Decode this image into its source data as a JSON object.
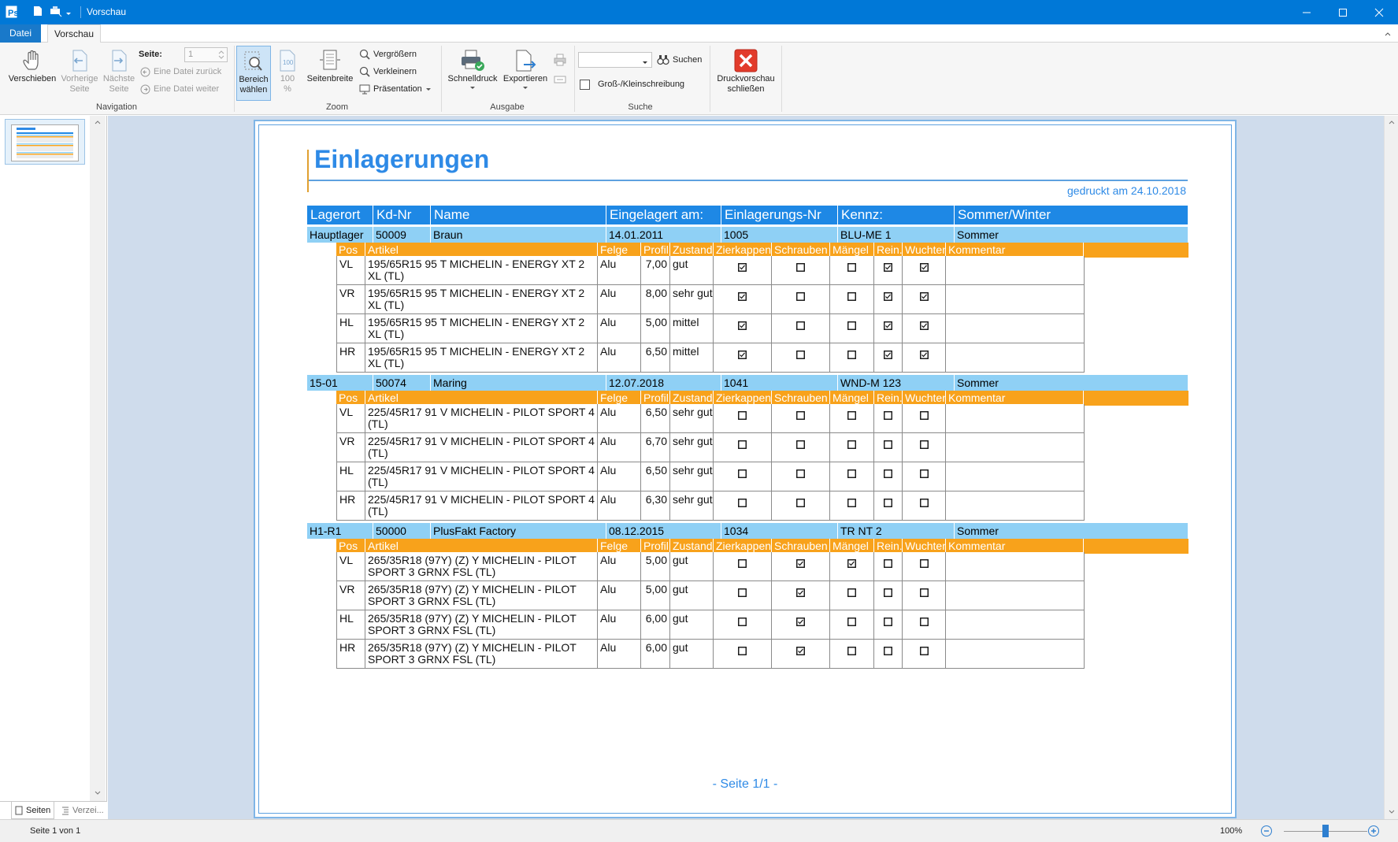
{
  "window": {
    "title": "Vorschau"
  },
  "menu_tabs": [
    {
      "label": "Datei"
    },
    {
      "label": "Vorschau"
    }
  ],
  "ribbon": {
    "navigation": {
      "group_label": "Navigation",
      "move_label": "Verschieben",
      "prev_label_1": "Vorherige",
      "prev_label_2": "Seite",
      "next_label_1": "Nächste",
      "next_label_2": "Seite",
      "page_label": "Seite:",
      "page_value": "1",
      "file_back_label": "Eine Datei zurück",
      "file_fwd_label": "Eine Datei weiter"
    },
    "zoom": {
      "group_label": "Zoom",
      "area_label_1": "Bereich",
      "area_label_2": "wählen",
      "hundred_label_1": "100",
      "hundred_label_2": "%",
      "pagewidth_label": "Seitenbreite",
      "zoom_in_label": "Vergrößern",
      "zoom_out_label": "Verkleinern",
      "presentation_label": "Präsentation"
    },
    "output": {
      "group_label": "Ausgabe",
      "quickprint_label": "Schnelldruck",
      "export_label": "Exportieren"
    },
    "search": {
      "group_label": "Suche",
      "search_label": "Suchen",
      "case_label": "Groß-/Kleinschreibung",
      "search_value": ""
    },
    "close": {
      "label_1": "Druckvorschau",
      "label_2": "schließen"
    }
  },
  "left_panel": {
    "tab_pages": "Seiten",
    "tab_index": "Verzei..."
  },
  "report": {
    "title": "Einlagerungen",
    "printed": "gedruckt am 24.10.2018",
    "footer": "- Seite 1/1 -",
    "headers": [
      "Lagerort",
      "Kd-Nr",
      "Name",
      "Eingelagert am:",
      "Einlagerungs-Nr",
      "Kennz:",
      "Sommer/Winter"
    ],
    "sub_headers": [
      "Pos",
      "Artikel",
      "Felge",
      "Profil",
      "Zustand",
      "Zierkappen",
      "Schrauben",
      "Mängel",
      "Rein.",
      "Wuchten",
      "Kommentar"
    ],
    "groups": [
      {
        "lagerort": "Hauptlager",
        "kdnr": "50009",
        "name": "Braun",
        "date": "14.01.2011",
        "nr": "1005",
        "kennz": "BLU-ME 1",
        "season": "Sommer",
        "items": [
          {
            "pos": "VL",
            "artikel": "195/65R15 95 T MICHELIN - ENERGY XT 2 XL (TL)",
            "felge": "Alu",
            "profil": "7,00",
            "zustand": "gut",
            "checks": [
              true,
              false,
              false,
              true,
              true
            ],
            "kommentar": ""
          },
          {
            "pos": "VR",
            "artikel": "195/65R15 95 T MICHELIN - ENERGY XT 2 XL (TL)",
            "felge": "Alu",
            "profil": "8,00",
            "zustand": "sehr gut",
            "checks": [
              true,
              false,
              false,
              true,
              true
            ],
            "kommentar": ""
          },
          {
            "pos": "HL",
            "artikel": "195/65R15 95 T MICHELIN - ENERGY XT 2 XL (TL)",
            "felge": "Alu",
            "profil": "5,00",
            "zustand": "mittel",
            "checks": [
              true,
              false,
              false,
              true,
              true
            ],
            "kommentar": ""
          },
          {
            "pos": "HR",
            "artikel": "195/65R15 95 T MICHELIN - ENERGY XT 2 XL (TL)",
            "felge": "Alu",
            "profil": "6,50",
            "zustand": "mittel",
            "checks": [
              true,
              false,
              false,
              true,
              true
            ],
            "kommentar": ""
          }
        ]
      },
      {
        "lagerort": "15-01",
        "kdnr": "50074",
        "name": "Maring",
        "date": "12.07.2018",
        "nr": "1041",
        "kennz": "WND-M 123",
        "season": "Sommer",
        "items": [
          {
            "pos": "VL",
            "artikel": "225/45R17 91 V MICHELIN - PILOT SPORT 4 (TL)",
            "felge": "Alu",
            "profil": "6,50",
            "zustand": "sehr gut",
            "checks": [
              false,
              false,
              false,
              false,
              false
            ],
            "kommentar": ""
          },
          {
            "pos": "VR",
            "artikel": "225/45R17 91 V MICHELIN - PILOT SPORT 4 (TL)",
            "felge": "Alu",
            "profil": "6,70",
            "zustand": "sehr gut",
            "checks": [
              false,
              false,
              false,
              false,
              false
            ],
            "kommentar": ""
          },
          {
            "pos": "HL",
            "artikel": "225/45R17 91 V MICHELIN - PILOT SPORT 4 (TL)",
            "felge": "Alu",
            "profil": "6,50",
            "zustand": "sehr gut",
            "checks": [
              false,
              false,
              false,
              false,
              false
            ],
            "kommentar": ""
          },
          {
            "pos": "HR",
            "artikel": "225/45R17 91 V MICHELIN - PILOT SPORT 4 (TL)",
            "felge": "Alu",
            "profil": "6,30",
            "zustand": "sehr gut",
            "checks": [
              false,
              false,
              false,
              false,
              false
            ],
            "kommentar": ""
          }
        ]
      },
      {
        "lagerort": "H1-R1",
        "kdnr": "50000",
        "name": "PlusFakt Factory",
        "date": "08.12.2015",
        "nr": "1034",
        "kennz": "TR NT 2",
        "season": "Sommer",
        "items": [
          {
            "pos": "VL",
            "artikel": "265/35R18 (97Y) (Z) Y MICHELIN - PILOT SPORT 3 GRNX FSL (TL)",
            "felge": "Alu",
            "profil": "5,00",
            "zustand": "gut",
            "checks": [
              false,
              true,
              true,
              false,
              false
            ],
            "kommentar": ""
          },
          {
            "pos": "VR",
            "artikel": "265/35R18 (97Y) (Z) Y MICHELIN - PILOT SPORT 3 GRNX FSL (TL)",
            "felge": "Alu",
            "profil": "5,00",
            "zustand": "gut",
            "checks": [
              false,
              true,
              false,
              false,
              false
            ],
            "kommentar": ""
          },
          {
            "pos": "HL",
            "artikel": "265/35R18 (97Y) (Z) Y MICHELIN - PILOT SPORT 3 GRNX FSL (TL)",
            "felge": "Alu",
            "profil": "6,00",
            "zustand": "gut",
            "checks": [
              false,
              true,
              false,
              false,
              false
            ],
            "kommentar": ""
          },
          {
            "pos": "HR",
            "artikel": "265/35R18 (97Y) (Z) Y MICHELIN - PILOT SPORT 3 GRNX FSL (TL)",
            "felge": "Alu",
            "profil": "6,00",
            "zustand": "gut",
            "checks": [
              false,
              true,
              false,
              false,
              false
            ],
            "kommentar": ""
          }
        ]
      }
    ]
  },
  "status": {
    "page_info": "Seite 1 von 1",
    "zoom": "100%",
    "zoom_level": 0.5
  },
  "colors": {
    "accent": "#0078d7",
    "header": "#1e88e5",
    "group_row": "#8fd0f5",
    "sub_header": "#f8a21b",
    "title": "#2e8ae6"
  }
}
